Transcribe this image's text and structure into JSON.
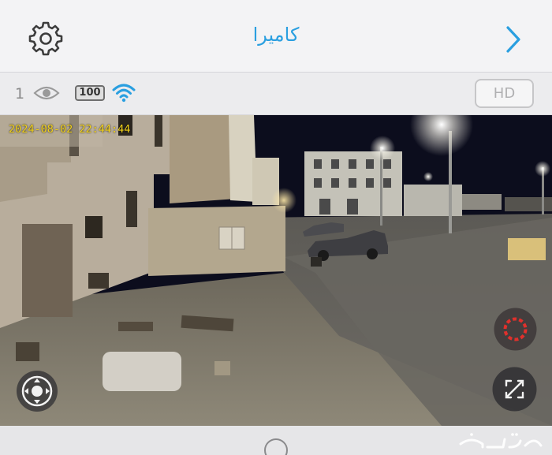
{
  "header": {
    "title": "كاميرا",
    "settings_icon": "gear-icon",
    "back_icon": "chevron-right-icon",
    "accent_color": "#2a9fe0"
  },
  "status": {
    "viewer_count": "1",
    "viewer_icon": "eye-icon",
    "battery_level": "100",
    "signal_icon": "wifi-icon",
    "quality_label": "HD"
  },
  "video": {
    "timestamp": "2024-08-02 22:44:44",
    "ptz_icon": "ptz-control-icon",
    "record_icon": "record-icon",
    "fullscreen_icon": "fullscreen-icon"
  },
  "footer": {
    "home_icon": "home-circle-icon",
    "watermark": "حراج"
  }
}
